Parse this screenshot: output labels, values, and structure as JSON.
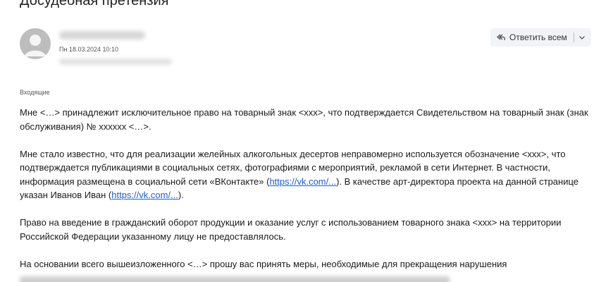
{
  "email": {
    "subject": "Досудебная претензия",
    "date": "Пн 18.03.2024 10:10",
    "folder": "Входящие",
    "reply_all_label": "Ответить всем",
    "para1": "Мне <…> принадлежит исключительное право на товарный знак <xxx>, что подтверждается Свидетельством на товарный знак (знак обслуживания) № xxxxxx <…>.",
    "para2_a": "Мне стало известно, что для реализации желейных алкогольных десертов неправомерно используется обозначение <xxx>, что подтверждается публикациями в социальных сетях, фотографиями с мероприятий, рекламой в сети Интернет. В частности, информация размещена в социальной сети «ВКонтакте» (",
    "link1": "https://vk.com/...",
    "para2_b": "). В качестве арт-директора проекта на данной странице указан Иванов Иван (",
    "link2": "https://vk.com/...",
    "para2_c": ").",
    "para3": "Право на введение в гражданский оборот продукции и оказание услуг с использованием товарного знака <xxx> на территории Российской Федерации указанному лицу не предоставлялось.",
    "para4": "На основании всего вышеизложенного <…> прошу вас принять меры, необходимые для прекращения нарушения"
  },
  "icons": {
    "avatar": "user-avatar-icon",
    "reply_all": "reply-all-icon",
    "dropdown": "chevron-down-icon"
  }
}
